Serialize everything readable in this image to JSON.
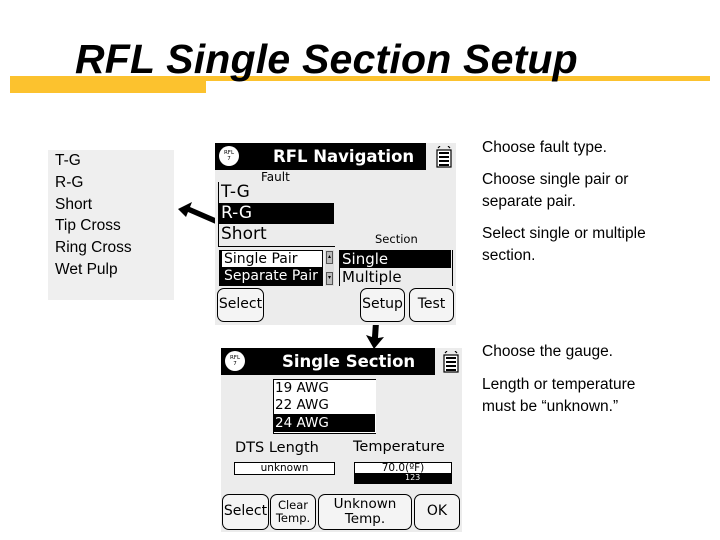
{
  "slide": {
    "title": "RFL Single Section Setup",
    "accent_color": "#fcc22e"
  },
  "fault_types_callout": {
    "items": [
      "T-G",
      "R-G",
      "Short",
      "Tip Cross",
      "Ring Cross",
      "Wet Pulp"
    ]
  },
  "screen_navigation": {
    "badge_line1": "RFL",
    "badge_line2": "7",
    "title": "RFL Navigation",
    "fault_label": "Fault",
    "fault_options": [
      "T-G",
      "R-G",
      "Short"
    ],
    "fault_selected": "R-G",
    "section_label": "Section",
    "pair_options": [
      "Single Pair",
      "Separate Pair"
    ],
    "section_options": [
      "Single",
      "Multiple"
    ],
    "section_selected": "Single",
    "buttons": {
      "select": "Select",
      "setup": "Setup",
      "test": "Test"
    },
    "battery_icon": "battery-icon"
  },
  "screen_single_section": {
    "badge_line1": "RFL",
    "badge_line2": "7",
    "title": "Single Section",
    "gauge_options": [
      "19 AWG",
      "22 AWG",
      "24 AWG"
    ],
    "gauge_selected": "24 AWG",
    "dts_length_label": "DTS Length",
    "dts_length_value": "unknown",
    "temperature_label": "Temperature",
    "temperature_value": "70.0(ºF)",
    "keypad_hint": "123",
    "buttons": {
      "select": "Select",
      "clear_temp_line1": "Clear",
      "clear_temp_line2": "Temp.",
      "unknown_temp_line1": "Unknown",
      "unknown_temp_line2": "Temp.",
      "ok": "OK"
    }
  },
  "instructions": [
    "Choose fault type.",
    "Choose single pair or separate pair.",
    "Select single or multiple section.",
    "Choose the gauge.",
    "Length or temperature must be “unknown.”"
  ],
  "instructions_wrapped": {
    "i1": "Choose fault type.",
    "i2_l1": "Choose single pair or",
    "i2_l2": "separate pair.",
    "i3_l1": "Select single or multiple",
    "i3_l2": "section.",
    "i4": "Choose the gauge.",
    "i5_l1": "Length or temperature",
    "i5_l2": "must be “unknown.”"
  }
}
